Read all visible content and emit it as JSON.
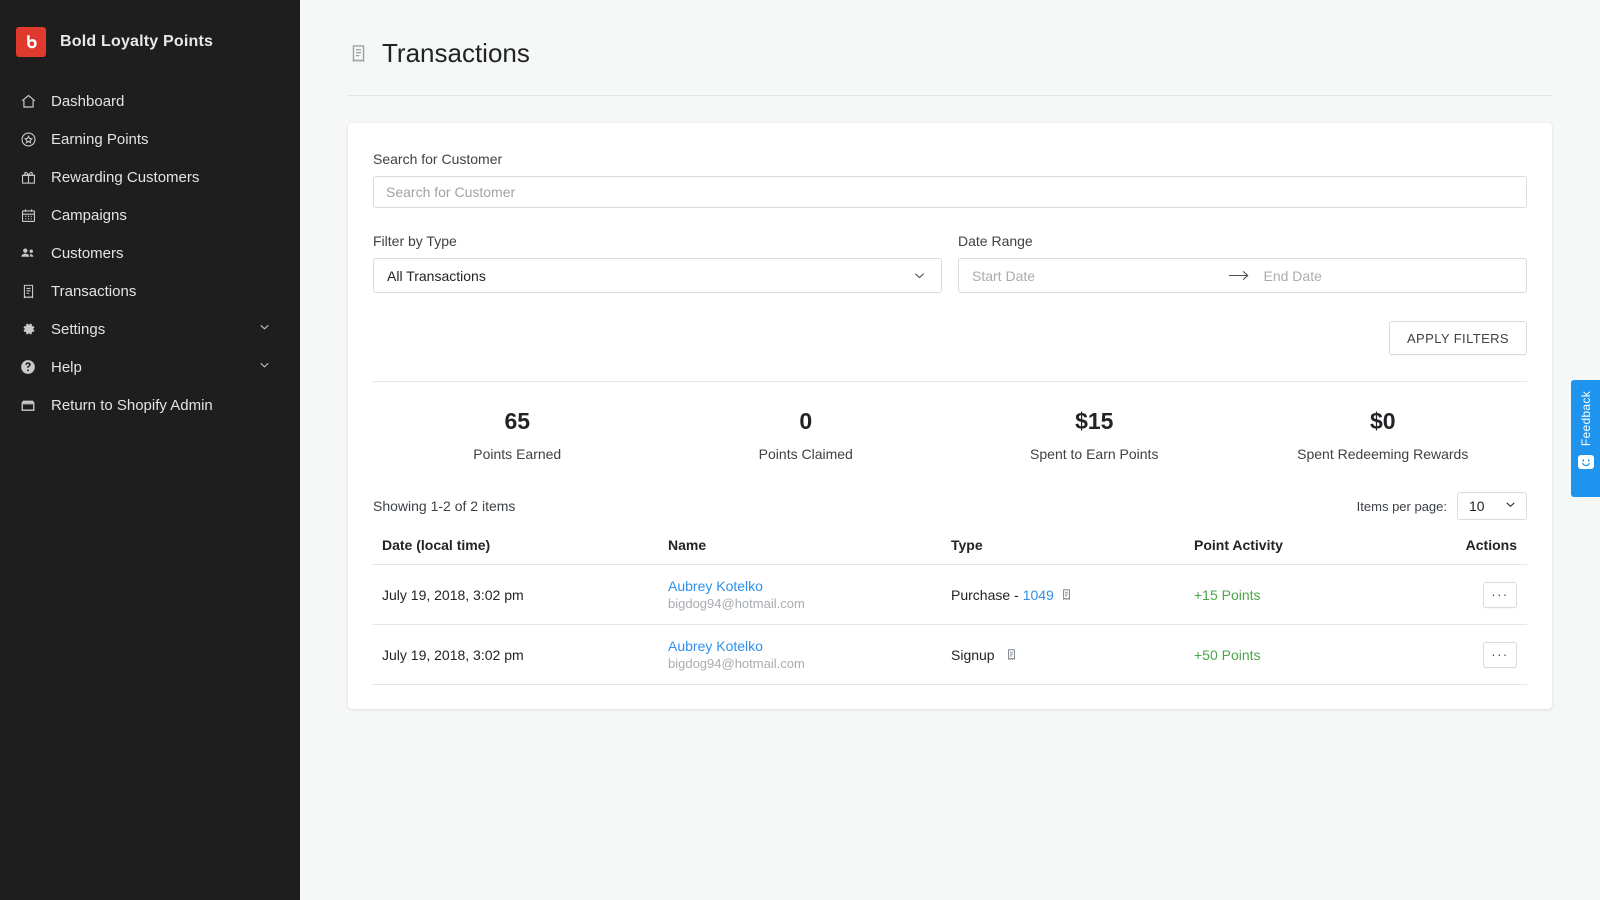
{
  "brand": {
    "name": "Bold Loyalty Points",
    "logo_letter": "b",
    "logo_color": "#e03a2f"
  },
  "sidebar": {
    "items": [
      {
        "label": "Dashboard",
        "icon": "home-icon",
        "chevron": false
      },
      {
        "label": "Earning Points",
        "icon": "star-circle-icon",
        "chevron": false
      },
      {
        "label": "Rewarding Customers",
        "icon": "gift-icon",
        "chevron": false
      },
      {
        "label": "Campaigns",
        "icon": "calendar-icon",
        "chevron": false
      },
      {
        "label": "Customers",
        "icon": "people-icon",
        "chevron": false
      },
      {
        "label": "Transactions",
        "icon": "receipt-icon",
        "chevron": false
      },
      {
        "label": "Settings",
        "icon": "gear-icon",
        "chevron": true
      },
      {
        "label": "Help",
        "icon": "question-circle-icon",
        "chevron": true
      },
      {
        "label": "Return to Shopify Admin",
        "icon": "storefront-icon",
        "chevron": false
      }
    ]
  },
  "header": {
    "title": "Transactions",
    "icon": "receipt-icon"
  },
  "filters": {
    "search_label": "Search for Customer",
    "search_value": "",
    "search_placeholder": "Search for Customer",
    "type_label": "Filter by Type",
    "type_value": "All Transactions",
    "date_label": "Date Range",
    "start_placeholder": "Start Date",
    "end_placeholder": "End Date",
    "start_value": "",
    "end_value": "",
    "apply_label": "APPLY FILTERS"
  },
  "stats": [
    {
      "value": "65",
      "label": "Points Earned"
    },
    {
      "value": "0",
      "label": "Points Claimed"
    },
    {
      "value": "$15",
      "label": "Spent to Earn Points"
    },
    {
      "value": "$0",
      "label": "Spent Redeeming Rewards"
    }
  ],
  "table_meta": {
    "showing": "Showing 1-2 of 2 items",
    "items_per_page_label": "Items per page:",
    "items_per_page_value": "10"
  },
  "table": {
    "headers": {
      "date": "Date (local time)",
      "name": "Name",
      "type": "Type",
      "point": "Point Activity",
      "actions": "Actions"
    },
    "rows": [
      {
        "date": "July 19, 2018, 3:02 pm",
        "name": "Aubrey Kotelko",
        "email": "bigdog94@hotmail.com",
        "type_prefix": "Purchase - ",
        "type_order": "1049",
        "type_has_note": true,
        "points": "+15 Points",
        "action": "···"
      },
      {
        "date": "July 19, 2018, 3:02 pm",
        "name": "Aubrey Kotelko",
        "email": "bigdog94@hotmail.com",
        "type_prefix": "Signup",
        "type_order": "",
        "type_has_note": true,
        "points": "+50 Points",
        "action": "···"
      }
    ]
  },
  "feedback": {
    "label": "Feedback",
    "icon": "smiley-icon",
    "color": "#1e94ef"
  },
  "colors": {
    "sidebar_bg": "#1e1e1e",
    "page_bg": "#f6f7f7",
    "link": "#2e90ea",
    "positive": "#4aa64a",
    "brand_red": "#e03a2f",
    "feedback_blue": "#1e94ef"
  }
}
